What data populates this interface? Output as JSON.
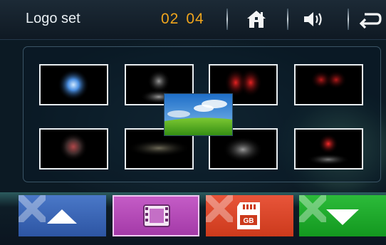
{
  "header": {
    "title": "Logo set",
    "page_current": "02",
    "page_total": "04",
    "home_icon": "home-icon",
    "volume_icon": "volume-icon",
    "back_icon": "back-arrow-icon"
  },
  "thumbnails": [
    {
      "id": "logo-1",
      "glow": "#6ab4ff"
    },
    {
      "id": "logo-2",
      "glow": "#9a9a9a"
    },
    {
      "id": "logo-3",
      "glow": "#d81e1e"
    },
    {
      "id": "logo-4",
      "glow": "#b01818"
    },
    {
      "id": "logo-5",
      "glow": "#b0484a"
    },
    {
      "id": "logo-6",
      "glow": "#6e6a58"
    },
    {
      "id": "logo-7",
      "glow": "#8a8a8a"
    },
    {
      "id": "logo-8",
      "glow": "#e02020"
    }
  ],
  "floating_image": "landscape-image",
  "buttons": {
    "up": {
      "icon": "up-arrow-icon",
      "color": "#3862b6"
    },
    "film": {
      "icon": "film-icon",
      "color": "#b548b8"
    },
    "sd": {
      "icon": "sd-card-icon",
      "label": "GB",
      "color": "#dc4121"
    },
    "down": {
      "icon": "down-arrow-icon",
      "color": "#19a427"
    }
  }
}
